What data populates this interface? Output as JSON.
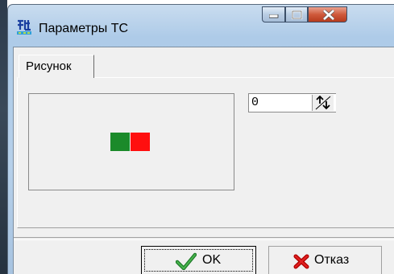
{
  "window": {
    "title": "Параметры ТС",
    "icon": "app-icon",
    "controls": [
      "minimize-icon",
      "maximize-icon",
      "close-icon"
    ]
  },
  "tabs": [
    {
      "label": "Рисунок",
      "active": true
    }
  ],
  "preview": {
    "swatches": [
      {
        "name": "green-swatch",
        "color": "#1b8a2a"
      },
      {
        "name": "red-swatch",
        "color": "#ff0f0f"
      }
    ]
  },
  "spinner": {
    "value": "0",
    "icon": "spin-up-down-icon"
  },
  "buttons": {
    "ok_label": "OK",
    "ok_icon": "checkmark-icon",
    "cancel_label": "Отказ",
    "cancel_icon": "red-x-icon"
  },
  "colors": {
    "accent_green": "#1b8a2a",
    "accent_red": "#ff0f0f",
    "close_button": "#c8472b"
  }
}
